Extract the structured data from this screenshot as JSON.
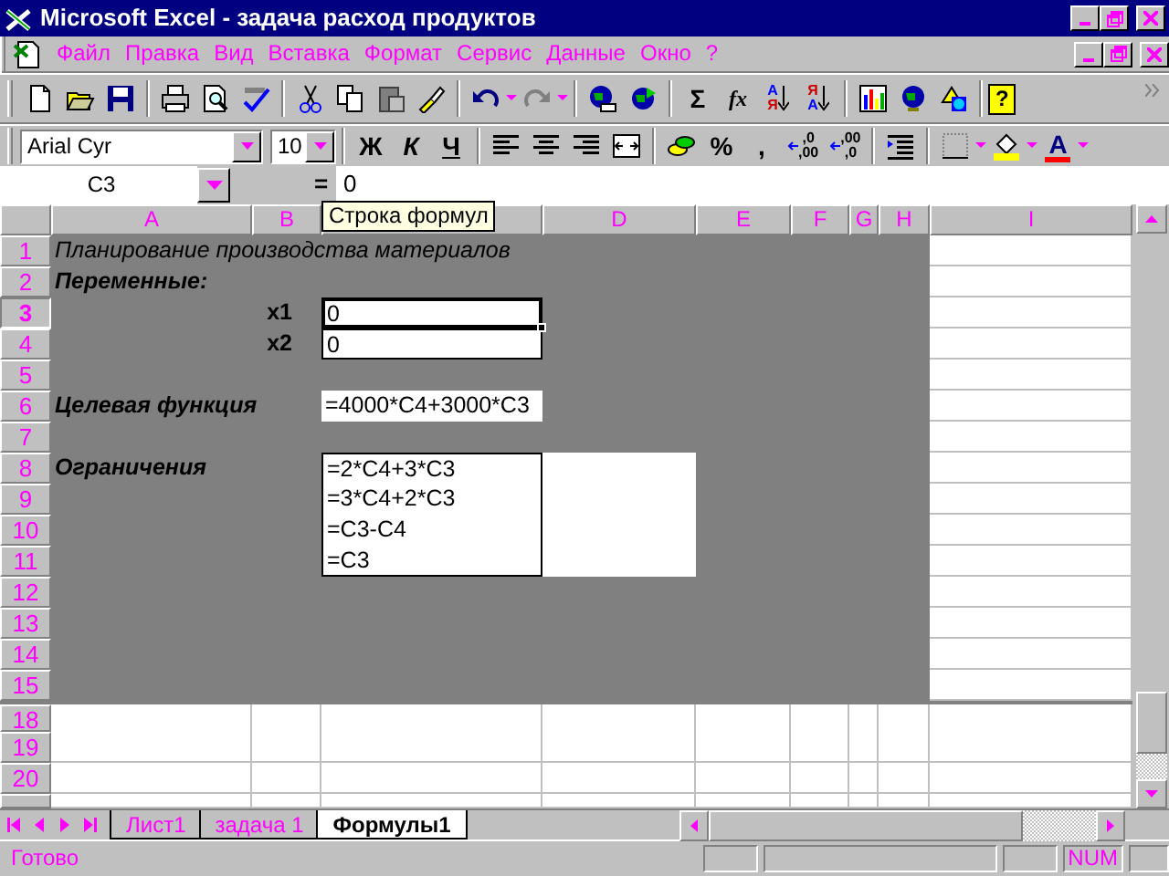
{
  "window": {
    "title": "Microsoft Excel - задача расход продуктов"
  },
  "menu": [
    {
      "label": "Файл"
    },
    {
      "label": "Правка"
    },
    {
      "label": "Вид"
    },
    {
      "label": "Вставка"
    },
    {
      "label": "Формат"
    },
    {
      "label": "Сервис"
    },
    {
      "label": "Данные"
    },
    {
      "label": "Окно"
    },
    {
      "label": "?"
    }
  ],
  "standard_toolbar": {
    "autosum": "Σ",
    "function": "fx",
    "sort": [
      {
        "top": "А",
        "bottom": "Я"
      },
      {
        "top": "Я",
        "bottom": "А"
      }
    ],
    "help": "?"
  },
  "formatting_toolbar": {
    "font": "Arial Cyr",
    "size": "10",
    "styles": [
      "Ж",
      "К",
      "Ч"
    ],
    "percent": "%",
    "comma": ",",
    "decimals": [
      {
        "top": ",0",
        "bottom": ",00"
      },
      {
        "top": ",00",
        "bottom": ",0"
      }
    ],
    "font_color": "A"
  },
  "formula_bar": {
    "name_box": "C3",
    "equals": "=",
    "value": "0",
    "tooltip": "Строка формул"
  },
  "columns": [
    {
      "label": "A"
    },
    {
      "label": "B"
    },
    {
      "kind": "covered"
    },
    {
      "label": "D"
    },
    {
      "label": "E"
    },
    {
      "label": "F"
    },
    {
      "label": "G"
    },
    {
      "label": "H"
    },
    {
      "label": "I"
    }
  ],
  "rows": [
    {
      "label": "1",
      "selected": false,
      "shaded": true,
      "hidden_above": false,
      "cells": {
        "A": {
          "text": "Планирование производства материалов",
          "kind": "title",
          "selected": false
        }
      }
    },
    {
      "label": "2",
      "selected": false,
      "shaded": true,
      "hidden_above": false,
      "cells": {
        "A": {
          "text": "Переменные:",
          "kind": "heading",
          "selected": false
        }
      }
    },
    {
      "label": "3",
      "selected": true,
      "shaded": true,
      "hidden_above": false,
      "cells": {
        "B": {
          "text": "x1",
          "kind": "var",
          "selected": false
        },
        "C": {
          "text": "0",
          "kind": "input",
          "selected": true
        }
      }
    },
    {
      "label": "4",
      "selected": false,
      "shaded": true,
      "hidden_above": false,
      "cells": {
        "B": {
          "text": "x2",
          "kind": "var",
          "selected": false
        },
        "C": {
          "text": "0",
          "kind": "input",
          "selected": false
        }
      }
    },
    {
      "label": "5",
      "selected": false,
      "shaded": true,
      "hidden_above": false,
      "cells": {}
    },
    {
      "label": "6",
      "selected": false,
      "shaded": true,
      "hidden_above": false,
      "cells": {
        "A": {
          "text": "Целевая функция",
          "kind": "heading",
          "selected": false
        },
        "C": {
          "text": "=4000*C4+3000*C3",
          "kind": "formula",
          "selected": false
        }
      }
    },
    {
      "label": "7",
      "selected": false,
      "shaded": true,
      "hidden_above": false,
      "cells": {}
    },
    {
      "label": "8",
      "selected": false,
      "shaded": true,
      "hidden_above": false,
      "cells": {
        "A": {
          "text": "Ограничения",
          "kind": "heading",
          "selected": false
        },
        "C": {
          "text": "=2*C4+3*C3",
          "kind": "box",
          "selected": false
        },
        "D": {
          "kind": "blank",
          "selected": false
        }
      }
    },
    {
      "label": "9",
      "selected": false,
      "shaded": true,
      "hidden_above": false,
      "cells": {
        "C": {
          "text": "=3*C4+2*C3",
          "kind": "box",
          "selected": false
        },
        "D": {
          "kind": "blank",
          "selected": false
        }
      }
    },
    {
      "label": "10",
      "selected": false,
      "shaded": true,
      "hidden_above": false,
      "cells": {
        "C": {
          "text": "=C3-C4",
          "kind": "box",
          "selected": false
        },
        "D": {
          "kind": "blank",
          "selected": false
        }
      }
    },
    {
      "label": "11",
      "selected": false,
      "shaded": true,
      "hidden_above": false,
      "cells": {
        "C": {
          "text": "=C3",
          "kind": "box",
          "selected": false
        },
        "D": {
          "kind": "blank",
          "selected": false
        }
      }
    },
    {
      "label": "12",
      "selected": false,
      "shaded": true,
      "hidden_above": false,
      "cells": {}
    },
    {
      "label": "13",
      "selected": false,
      "shaded": true,
      "hidden_above": false,
      "cells": {}
    },
    {
      "label": "14",
      "selected": false,
      "shaded": true,
      "hidden_above": false,
      "cells": {}
    },
    {
      "label": "15",
      "selected": false,
      "shaded": true,
      "hidden_above": false,
      "cells": {}
    },
    {
      "label": "18",
      "selected": false,
      "shaded": false,
      "hidden_above": true,
      "cells": {}
    },
    {
      "label": "19",
      "selected": false,
      "shaded": false,
      "hidden_above": false,
      "cells": {}
    },
    {
      "label": "20",
      "selected": false,
      "shaded": false,
      "hidden_above": false,
      "cells": {}
    }
  ],
  "sheet_tabs": [
    {
      "label": "Лист1",
      "selected": false
    },
    {
      "label": "задача 1",
      "selected": false
    },
    {
      "label": "Формулы1",
      "selected": true
    }
  ],
  "status_bar": {
    "text": "Готово",
    "indicator": "NUM"
  }
}
